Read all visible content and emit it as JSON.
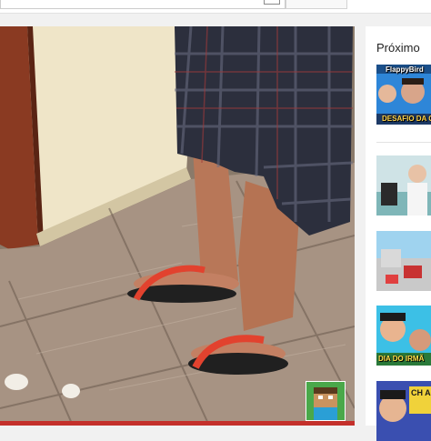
{
  "sidebar": {
    "up_next_label": "Próximo",
    "videos": [
      {
        "thumbnail_text": "FlappyBird",
        "thumbnail_caption": "DESAFIO DA CA"
      },
      {
        "thumbnail_text": "",
        "thumbnail_caption": ""
      },
      {
        "thumbnail_text": "",
        "thumbnail_caption": ""
      },
      {
        "thumbnail_text": "",
        "thumbnail_caption": "DIA DO IRMÃ"
      },
      {
        "thumbnail_text": "",
        "thumbnail_caption": "CH AG"
      }
    ]
  },
  "colors": {
    "progress": "#c4302b",
    "sidebar_bg": "#ffffff",
    "page_bg": "#f1f1f1"
  }
}
